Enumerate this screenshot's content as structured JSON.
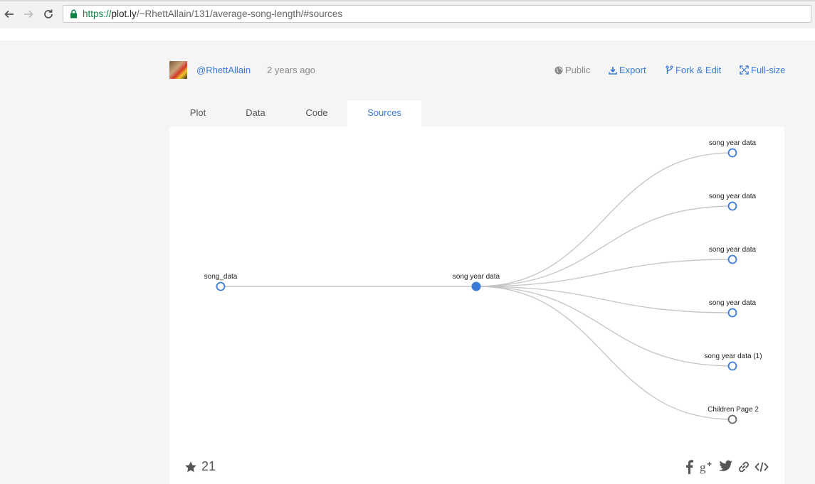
{
  "browser": {
    "url_scheme": "https://",
    "url_host": "plot.ly",
    "url_path": "/~RhettAllain/131/average-song-length/#sources"
  },
  "header": {
    "user": "@RhettAllain",
    "time_ago": "2 years ago",
    "actions": {
      "public": "Public",
      "export": "Export",
      "fork_edit": "Fork & Edit",
      "full_size": "Full-size"
    }
  },
  "tabs": [
    {
      "label": "Plot"
    },
    {
      "label": "Data"
    },
    {
      "label": "Code"
    },
    {
      "label": "Sources",
      "active": true
    }
  ],
  "sources_graph": {
    "root": {
      "label": "song_data"
    },
    "middle": {
      "label": "song year data"
    },
    "children": [
      {
        "label": "song year data"
      },
      {
        "label": "song year data"
      },
      {
        "label": "song year data"
      },
      {
        "label": "song year data"
      },
      {
        "label": "song year data (1)"
      },
      {
        "label": "Children Page 2"
      }
    ]
  },
  "footer": {
    "star_count": "21",
    "share_icons": [
      "facebook-icon",
      "google-plus-icon",
      "twitter-icon",
      "link-icon",
      "embed-icon"
    ]
  },
  "colors": {
    "accent": "#3b7bd4",
    "node_fill": "#3b7bd4",
    "link": "#c4c4c4"
  }
}
